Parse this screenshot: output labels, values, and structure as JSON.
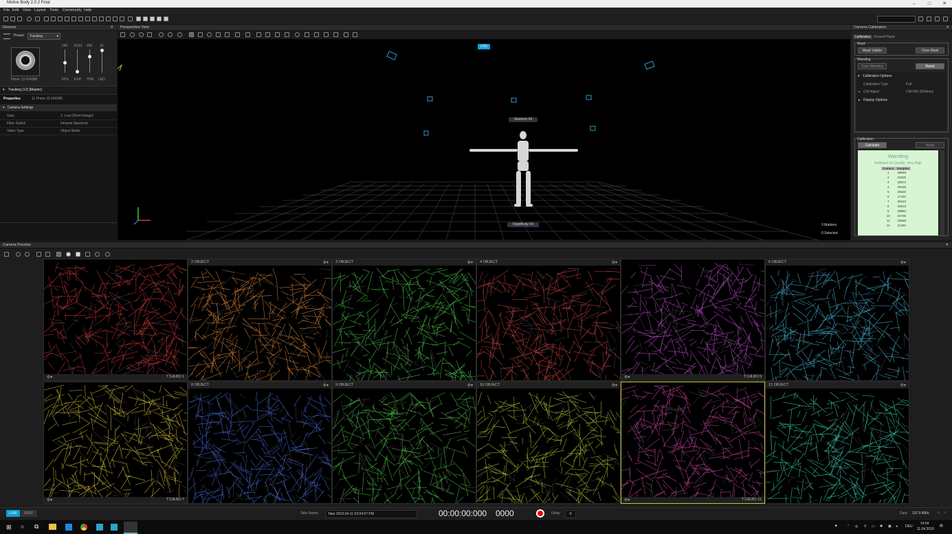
{
  "window": {
    "title": "Motive Body 2.0.2 Final"
  },
  "menu": [
    "File",
    "Edit",
    "View",
    "Layout",
    "Tools",
    "Community",
    "Help"
  ],
  "devices": {
    "title": "Devices",
    "preset_label": "Preset:",
    "preset_value": "Tracking",
    "camera_name": "Prime 13 #34388",
    "sliders": [
      {
        "label": "FPS",
        "value": "240",
        "level": 0.5
      },
      {
        "label": "EXP",
        "value": "8133",
        "level": 0.1
      },
      {
        "label": "THR",
        "value": "255",
        "level": 0.6
      },
      {
        "label": "LED",
        "value": "15",
        "level": 0.95
      }
    ],
    "tracking_group": "Tracking (12) [Master]"
  },
  "properties": {
    "title": "Properties",
    "subtitle": "11 Prime 13 #34388",
    "section": "Camera Settings",
    "rows": [
      {
        "key": "Gain",
        "value": "1: Low (Short Range)"
      },
      {
        "key": "Filter Switch",
        "value": "Infrared Spectrum"
      },
      {
        "key": "Video Type",
        "value": "Object Mode"
      }
    ]
  },
  "perspective": {
    "title": "Perspective View",
    "live_badge": "LIVE",
    "skeleton_label": "Skeleton 04",
    "rigid_label": "RigidBody 04",
    "markers": "3 Markers",
    "selected": "0 Selected"
  },
  "calibration": {
    "title": "Camera Calibration",
    "tabs": [
      "Calibration",
      "Ground Plane"
    ],
    "mask_label": "Mask",
    "mask_visible": "Mask Visible",
    "clear_mask": "Clear Mask",
    "wanding_label": "Wanding",
    "start_wanding": "Start Wanding",
    "reset": "Reset",
    "options_title": "Calibration Options",
    "options": [
      {
        "key": "Calibration Type",
        "value": "Full"
      },
      {
        "key": "CW-Wand",
        "value": "CW-500 (500mm)"
      }
    ],
    "display_options": "Display Options",
    "calibration_label": "Calibration",
    "calculate": "Calculate",
    "apply": "Apply",
    "result_title": "Wanding",
    "result_quality": "Sufficient for Quality: Very High",
    "table_headers": [
      "Camera",
      "Samples"
    ],
    "table_rows": [
      [
        "1",
        "29848"
      ],
      [
        "2",
        "31925"
      ],
      [
        "3",
        "28973"
      ],
      [
        "4",
        "29159"
      ],
      [
        "5",
        "25526"
      ],
      [
        "6",
        "17192"
      ],
      [
        "7",
        "28183"
      ],
      [
        "8",
        "30813"
      ],
      [
        "9",
        "28882"
      ],
      [
        "10",
        "32736"
      ],
      [
        "11",
        "23558"
      ],
      [
        "12",
        "21293"
      ]
    ]
  },
  "camera_preview": {
    "title": "Camera Preview",
    "tiles": [
      {
        "num": "1",
        "mode": "OBJECT",
        "color": "#d43a3a",
        "flipped": true
      },
      {
        "num": "2",
        "mode": "OBJECT",
        "color": "#e08a3c"
      },
      {
        "num": "3",
        "mode": "OBJECT",
        "color": "#4ed14e"
      },
      {
        "num": "4",
        "mode": "OBJECT",
        "color": "#d04444"
      },
      {
        "num": "5",
        "mode": "OBJECT",
        "color": "#c14fd0",
        "flipped": true
      },
      {
        "num": "6",
        "mode": "OBJECT",
        "color": "#4ab8d8"
      },
      {
        "num": "7",
        "mode": "OBJECT",
        "color": "#d8c43a",
        "flipped": true
      },
      {
        "num": "8",
        "mode": "OBJECT",
        "color": "#4a6fe0"
      },
      {
        "num": "9",
        "mode": "OBJECT",
        "color": "#52c44e"
      },
      {
        "num": "10",
        "mode": "OBJECT",
        "color": "#b6c83a"
      },
      {
        "num": "11",
        "mode": "OBJECT",
        "color": "#d049a8",
        "flipped": true
      },
      {
        "num": "12",
        "mode": "OBJECT",
        "color": "#3ed4b0"
      }
    ]
  },
  "status": {
    "live": "LIVE",
    "edit": "EDIT",
    "take_label": "Take Name:",
    "take_value": "Take 2019-04-11 02:04:07 PM",
    "timecode": "00:00:00:000",
    "frame": "0000",
    "delay_label": "Delay",
    "delay_value": "0",
    "data_label": "Data:",
    "data_value": "137.5 KB/s"
  },
  "taskbar": {
    "lang": "DEU",
    "time": "14:04",
    "date": "11.04.2019"
  }
}
